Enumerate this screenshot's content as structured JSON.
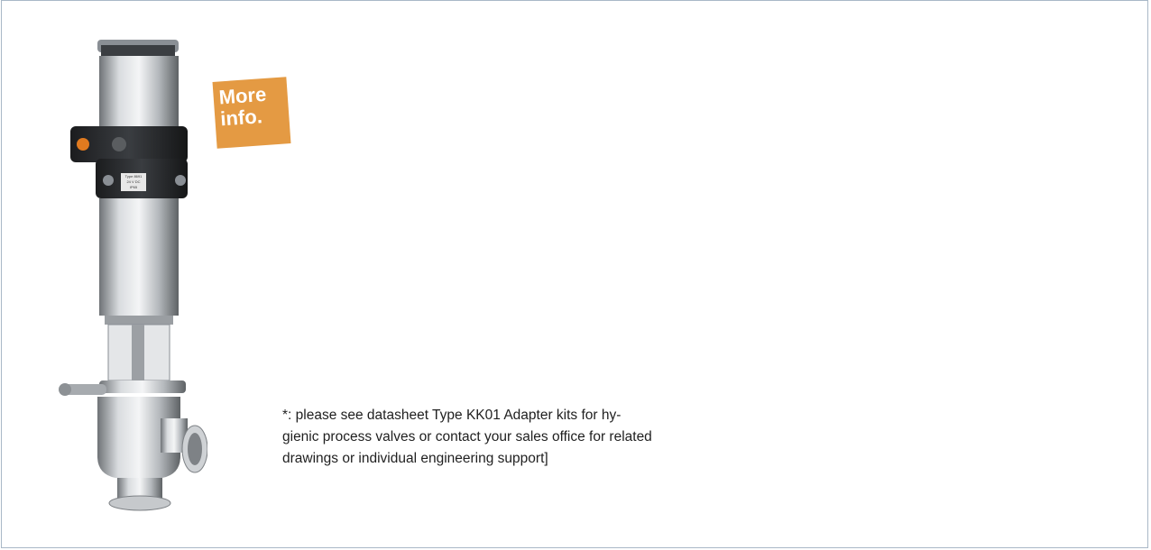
{
  "badge": {
    "line1": "More",
    "line2": "info.",
    "color": "#e49a43"
  },
  "footnote": {
    "lines": [
      "*: please see datasheet Type KK01 Adapter kits for hy-",
      "gienic process valves or contact your sales office for related",
      "drawings or individual engineering support]"
    ]
  },
  "colors": {
    "frame_border": "#a9b8c7",
    "steel": "#c9ccd0",
    "housing": "#2a2c2f"
  },
  "product_label": {
    "lines": [
      "Type 8691",
      "24 V DC",
      "IP65"
    ]
  }
}
